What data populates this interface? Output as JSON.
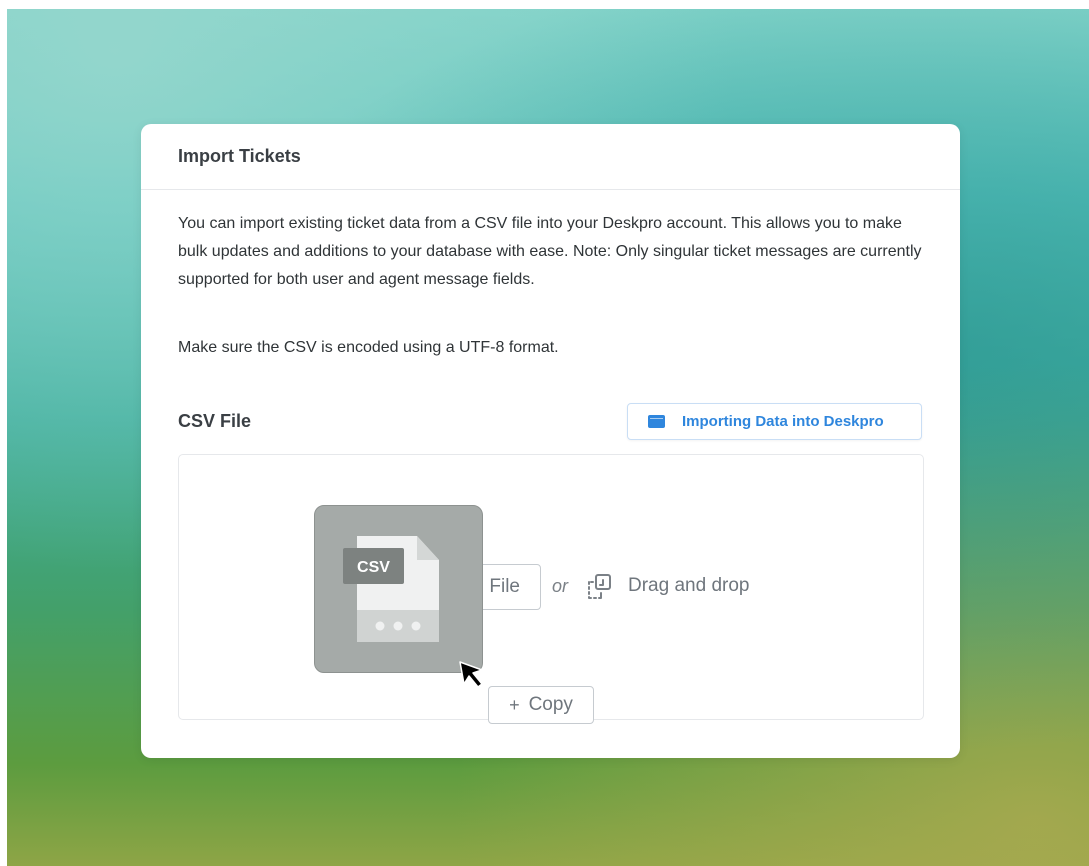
{
  "card": {
    "title": "Import Tickets",
    "description": "You can import existing ticket data from a CSV file into your Deskpro account. This allows you to make bulk updates and additions to your database with ease. Note: Only singular ticket messages are currently supported for both user and agent message fields.",
    "encoding_note": "Make sure the CSV is encoded using a UTF-8 format."
  },
  "csv_section": {
    "label": "CSV File",
    "guide_button": {
      "label": "Importing Data into Deskpro",
      "icon": "browser-window-icon"
    }
  },
  "dropzone": {
    "file_button_label": "File",
    "or_text": "or",
    "drag_icon": "drag-drop-icon",
    "drag_text": "Drag and drop",
    "copy_chip": {
      "plus": "+",
      "label": "Copy"
    },
    "drag_preview": {
      "badge": "CSV",
      "icon": "csv-file-icon"
    },
    "cursor_icon": "arrow-cursor-icon"
  },
  "colors": {
    "accent": "#2f86dd",
    "title_text": "#3a3f44",
    "body_text": "#2f3437",
    "muted_text": "#6f767d",
    "preview_tile": "#a5aaa8",
    "file_icon": "#f0f1f1",
    "badge": "#7d8280"
  }
}
